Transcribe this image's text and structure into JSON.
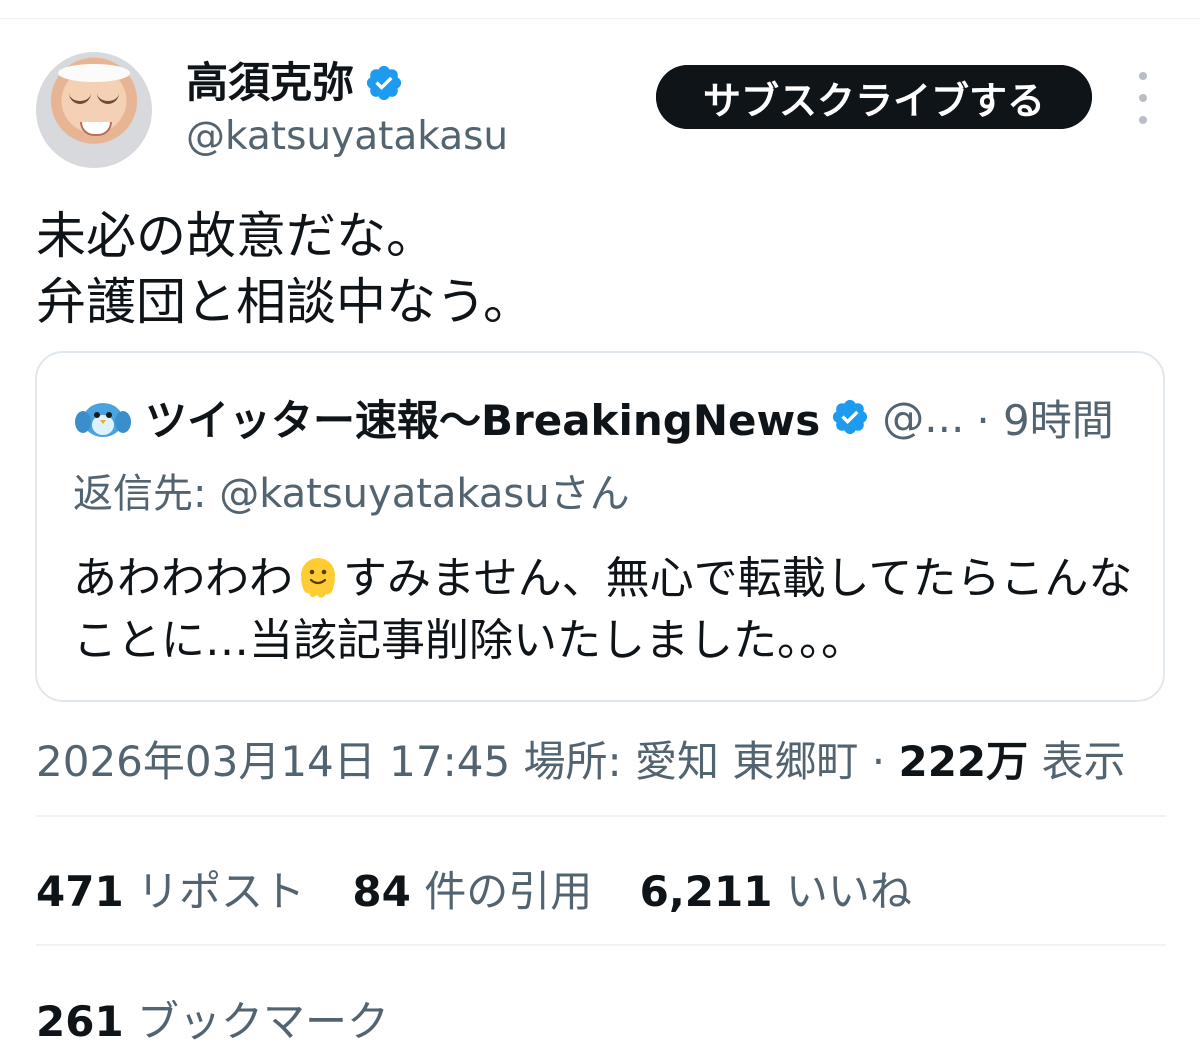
{
  "author": {
    "name": "高須克弥",
    "handle": "@katsuyatakasu"
  },
  "actions": {
    "subscribe_label": "サブスクライブする"
  },
  "tweet": {
    "text": "未必の故意だな。\n弁護団と相談中なう。",
    "timestamp": "2026年03月14日 17:45",
    "location_label": "場所: 愛知 東郷町",
    "views": "222万",
    "views_label": "表示"
  },
  "quoted": {
    "name": "ツイッター速報〜BreakingNews",
    "handle": "@...",
    "time": "· 9時間",
    "replying_to": "返信先: @katsuyatakasuさん",
    "text_before_emoji": "あわわわわ",
    "text_after_emoji": "すみません、無心で転載してたらこんなことに…当該記事削除いたしました。。。"
  },
  "stats": {
    "reposts": {
      "count": "471",
      "label": "リポスト"
    },
    "quotes": {
      "count": "84",
      "label": "件の引用"
    },
    "likes": {
      "count": "6,211",
      "label": "いいね"
    },
    "bookmarks": {
      "count": "261",
      "label": "ブックマーク"
    }
  },
  "colors": {
    "text_primary": "#0f1419",
    "text_secondary": "#536471",
    "verified_blue": "#1d9bf0",
    "button_dark": "#0f1419",
    "border": "#e1e8ed"
  },
  "icons": {
    "verified": "verified-badge-icon",
    "more": "more-vertical-icon",
    "quoted_avatar": "bird-avatar-icon",
    "emoji": "melting-face-emoji"
  }
}
